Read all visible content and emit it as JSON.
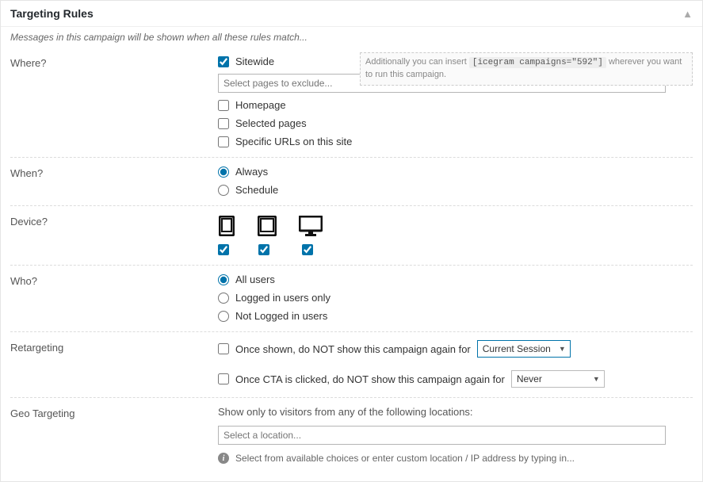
{
  "panel": {
    "title": "Targeting Rules",
    "intro": "Messages in this campaign will be shown when all these rules match..."
  },
  "where": {
    "label": "Where?",
    "sitewide": "Sitewide",
    "note_prefix": "Additionally you can insert",
    "note_code": "[icegram campaigns=\"592\"]",
    "note_suffix": "wherever you want to run this campaign.",
    "exclude_placeholder": "Select pages to exclude...",
    "options": [
      "Homepage",
      "Selected pages",
      "Specific URLs on this site"
    ]
  },
  "when": {
    "label": "When?",
    "options": [
      "Always",
      "Schedule"
    ]
  },
  "device": {
    "label": "Device?"
  },
  "who": {
    "label": "Who?",
    "options": [
      "All users",
      "Logged in users only",
      "Not Logged in users"
    ]
  },
  "retargeting": {
    "label": "Retargeting",
    "option1": "Once shown, do NOT show this campaign again for",
    "select1": "Current Session",
    "option2": "Once CTA is clicked, do NOT show this campaign again for",
    "select2": "Never"
  },
  "geo": {
    "label": "Geo Targeting",
    "subtitle": "Show only to visitors from any of the following locations:",
    "placeholder": "Select a location...",
    "hint": "Select from available choices or enter custom location / IP address by typing in..."
  }
}
